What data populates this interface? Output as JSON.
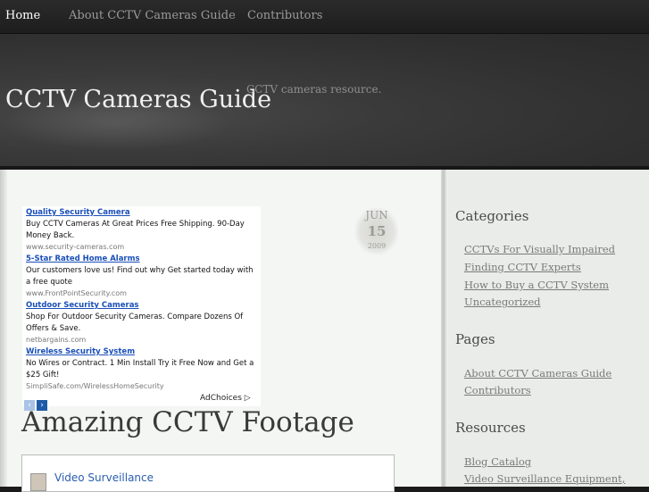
{
  "nav": {
    "items": [
      "Home",
      "About CCTV Cameras Guide",
      "Contributors"
    ]
  },
  "header": {
    "title": "CCTV Cameras Guide",
    "description": "CCTV cameras resource."
  },
  "ads": {
    "items": [
      {
        "title": "Quality Security Camera",
        "text": "Buy CCTV Cameras At Great Prices Free Shipping. 90-Day Money Back.",
        "url": "www.security-cameras.com"
      },
      {
        "title": "5-Star Rated Home Alarms",
        "text": "Our customers love us! Find out why Get started today with a free quote",
        "url": "www.FrontPointSecurity.com"
      },
      {
        "title": "Outdoor Security Cameras",
        "text": "Shop For Outdoor Security Cameras. Compare Dozens Of Offers & Save.",
        "url": "netbargains.com"
      },
      {
        "title": "Wireless Security System",
        "text": "No Wires or Contract. 1 Min Install Try it Free Now and Get a $25 Gift!",
        "url": "SimpliSafe.com/WirelessHomeSecurity"
      }
    ],
    "adchoices": "AdChoices ▷",
    "prev": "‹",
    "next": "›"
  },
  "post": {
    "date": {
      "month": "JUN",
      "day": "15",
      "year": "2009"
    },
    "title": "Amazing CCTV Footage",
    "widget_link": "Video Surveillance"
  },
  "sidebar": {
    "categories": {
      "heading": "Categories",
      "items": [
        "CCTVs For Visually Impaired",
        "Finding CCTV Experts",
        "How to Buy a CCTV System",
        "Uncategorized"
      ]
    },
    "pages": {
      "heading": "Pages",
      "items": [
        "About CCTV Cameras Guide",
        "Contributors"
      ]
    },
    "resources": {
      "heading": "Resources",
      "items": [
        "Blog Catalog",
        "Video Surveillance Equipment,"
      ]
    }
  },
  "colors": {
    "nav_bg": "#222222",
    "header_bg": "#353535",
    "content_bg": "#f4f6f3",
    "ad_link": "#1a4fb8"
  }
}
